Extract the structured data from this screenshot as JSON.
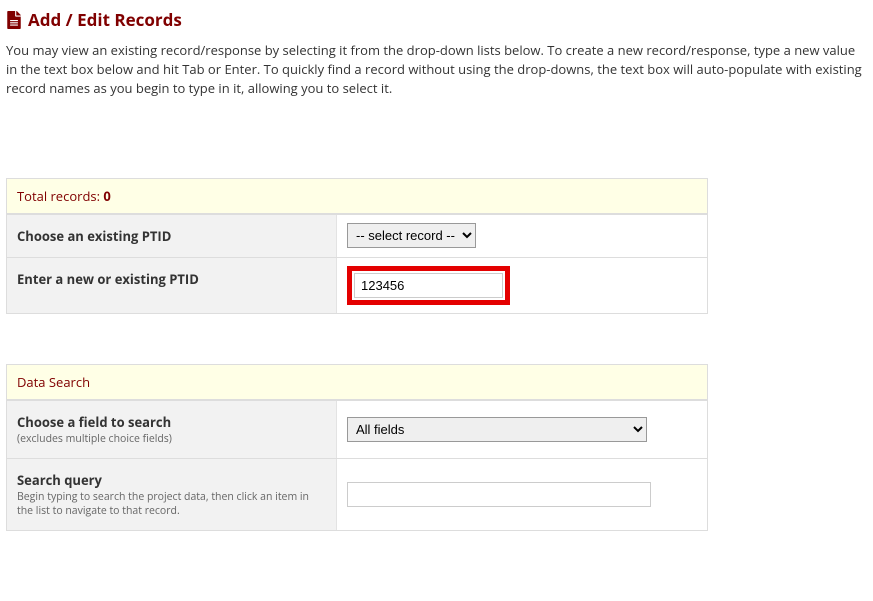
{
  "header": {
    "title": "Add / Edit Records",
    "description": "You may view an existing record/response by selecting it from the drop-down lists below. To create a new record/response, type a new value in the text box below and hit Tab or Enter. To quickly find a record without using the drop-downs, the text box will auto-populate with existing record names as you begin to type in it, allowing you to select it."
  },
  "records_panel": {
    "total_label": "Total records: ",
    "total_count": "0",
    "choose_label": "Choose an existing PTID",
    "select_placeholder": "-- select record --",
    "enter_label": "Enter a new or existing PTID",
    "input_value": "123456"
  },
  "search_panel": {
    "header": "Data Search",
    "field_label": "Choose a field to search",
    "field_sublabel": "(excludes multiple choice fields)",
    "field_selected": "All fields",
    "query_label": "Search query",
    "query_sublabel": "Begin typing to search the project data, then click an item in the list to navigate to that record.",
    "query_value": ""
  }
}
